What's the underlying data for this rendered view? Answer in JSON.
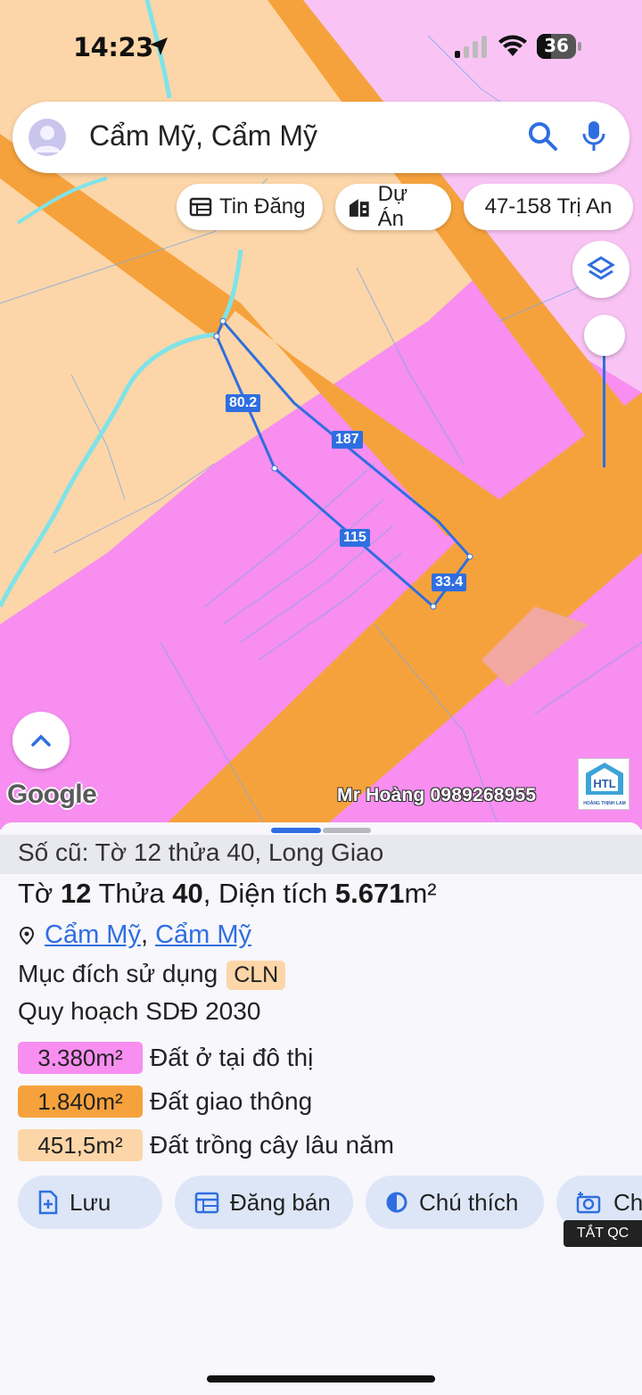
{
  "status": {
    "time": "14:23",
    "battery": "36",
    "battery_level": 0.36
  },
  "search": {
    "text": "Cẩm Mỹ, Cẩm Mỹ"
  },
  "chips": {
    "listings": "Tin Đăng",
    "projects": "Dự Án",
    "address": "47-158 Trị An"
  },
  "map": {
    "edge_labels": [
      "80.2",
      "187",
      "115",
      "33.4"
    ],
    "google": "Google",
    "watermark": "Mr Hoàng 0989268955",
    "brand": "HOÀNG THỊNH LAM"
  },
  "sheet": {
    "old_number": "Số cũ: Tờ 12 thửa 40, Long Giao",
    "title": {
      "prefix": "Tờ",
      "sheet_no": "12",
      "plot_word": "Thửa",
      "plot_no": "40",
      "area_word": ", Diện tích",
      "area": "5.671",
      "unit": "m²"
    },
    "address": {
      "commune": "Cẩm Mỹ",
      "separator": ",",
      "district": "Cẩm Mỹ"
    },
    "purpose_label": "Mục đích sử dụng",
    "purpose_code": "CLN",
    "plan_title": "Quy hoạch SDĐ 2030",
    "zones": [
      {
        "area": "3.380m²",
        "label": "Đất ở tại đô thị",
        "color": "#f78ef0"
      },
      {
        "area": "1.840m²",
        "label": "Đất giao thông",
        "color": "#f6a23c"
      },
      {
        "area": "451,5m²",
        "label": "Đất trồng cây lâu năm",
        "color": "#fcd6a8"
      }
    ],
    "actions": {
      "save": "Lưu",
      "post": "Đăng bán",
      "legend": "Chú thích",
      "capture": "Ch"
    },
    "ad_off": "TẮT QC"
  },
  "colors": {
    "accent": "#2f6ee0",
    "residential": "#f78ef0",
    "road": "#f6a23c",
    "perennial": "#fcd6a8"
  }
}
